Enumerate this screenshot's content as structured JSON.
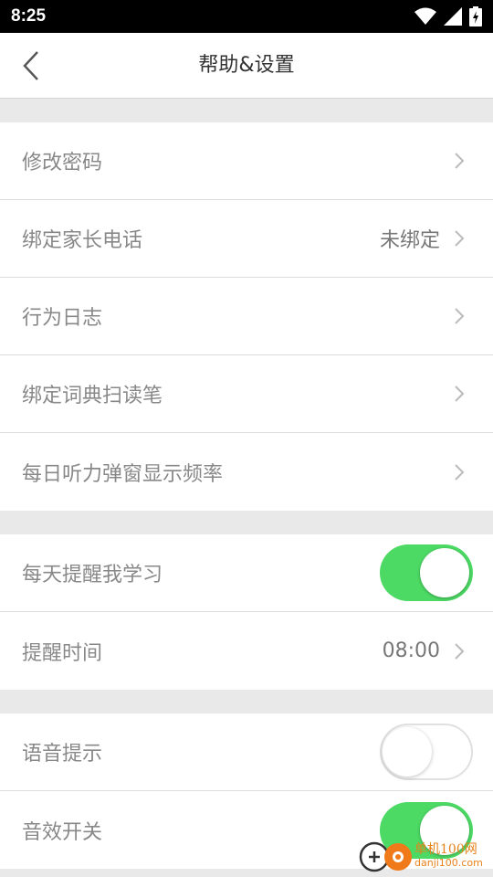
{
  "status_bar": {
    "time": "8:25"
  },
  "header": {
    "title": "帮助&设置"
  },
  "group1": [
    {
      "label": "修改密码",
      "value": ""
    },
    {
      "label": "绑定家长电话",
      "value": "未绑定"
    },
    {
      "label": "行为日志",
      "value": ""
    },
    {
      "label": "绑定词典扫读笔",
      "value": ""
    },
    {
      "label": "每日听力弹窗显示频率",
      "value": ""
    }
  ],
  "group2": {
    "reminder_toggle": {
      "label": "每天提醒我学习",
      "on": true
    },
    "reminder_time": {
      "label": "提醒时间",
      "value": "08:00"
    }
  },
  "group3": {
    "voice_prompt": {
      "label": "语音提示",
      "on": false
    },
    "sound_effects": {
      "label": "音效开关",
      "on": true
    }
  },
  "colors": {
    "toggle_on": "#4cd964",
    "separator": "#e9e9e9"
  },
  "watermark": {
    "name": "单机100网",
    "url": "danji100.com"
  }
}
